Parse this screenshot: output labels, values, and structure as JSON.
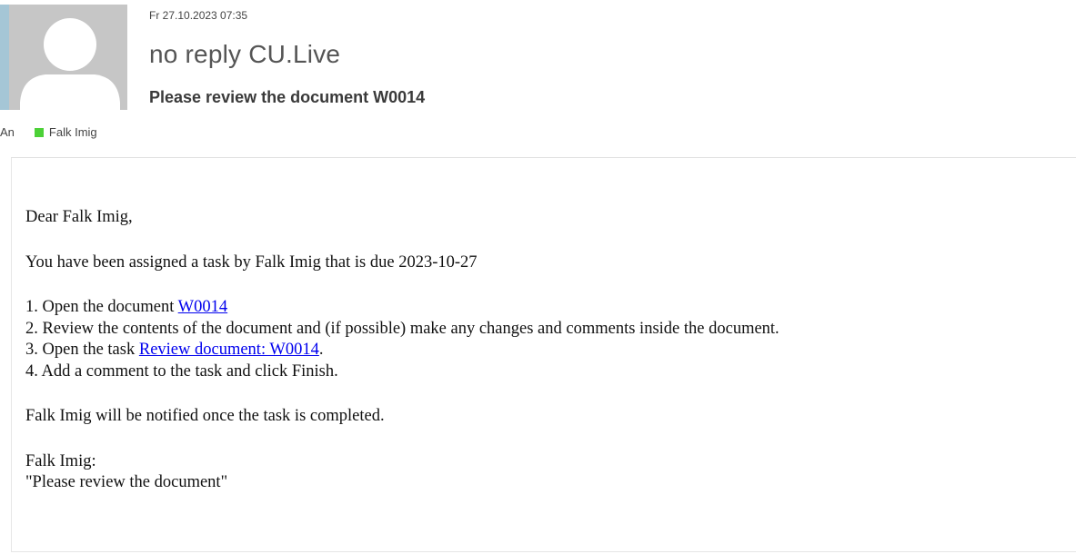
{
  "header": {
    "timestamp": "Fr 27.10.2023 07:35",
    "sender": "no reply CU.Live",
    "subject": "Please review the document W0014",
    "to_label": "An",
    "recipient": "Falk Imig"
  },
  "body": {
    "greeting": "Dear Falk Imig,",
    "assignment": "You have been assigned a task by Falk Imig that is due 2023-10-27",
    "step1_prefix": "1. Open the document ",
    "step1_link": "W0014",
    "step2": "2. Review the contents of the document and (if possible) make any changes and comments inside the document.",
    "step3_prefix": "3. Open the task ",
    "step3_link": "Review document: W0014",
    "step3_suffix": ".",
    "step4": "4. Add a comment to the task and click Finish.",
    "notice": "Falk Imig will be notified once the task is completed.",
    "comment_author": "Falk Imig:",
    "comment_text": "\"Please review the document\""
  },
  "colors": {
    "presence": "#4cd137",
    "link": "#0000ee",
    "avatar_bg": "#c6c6c6"
  },
  "icons": {
    "avatar": "person-silhouette-icon",
    "presence": "presence-status-icon"
  }
}
